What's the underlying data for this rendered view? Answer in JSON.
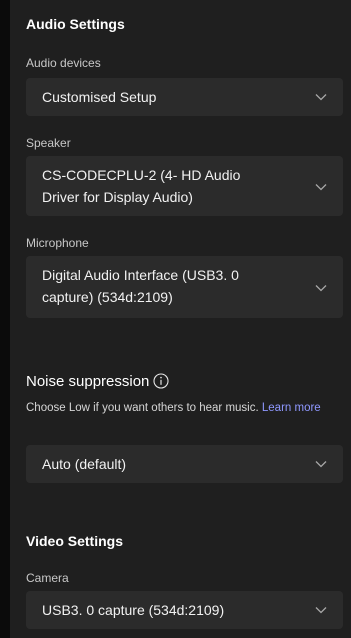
{
  "audio_settings": {
    "title": "Audio Settings",
    "audio_devices": {
      "label": "Audio devices",
      "value": "Customised Setup"
    },
    "speaker": {
      "label": "Speaker",
      "value_line1": "CS-CODECPLU-2 (4- HD Audio",
      "value_line2": "Driver for Display Audio)"
    },
    "microphone": {
      "label": "Microphone",
      "value_line1": "Digital Audio Interface (USB3. 0",
      "value_line2": "capture) (534d:2109)"
    },
    "noise_suppression": {
      "label": "Noise suppression",
      "hint": "Choose Low if you want others to hear music.",
      "link_text": "Learn more",
      "value": "Auto (default)"
    }
  },
  "video_settings": {
    "title": "Video Settings",
    "camera": {
      "label": "Camera",
      "value": "USB3. 0 capture (534d:2109)"
    }
  },
  "colors": {
    "panel_bg": "#1f1f1f",
    "dropdown_bg": "#2b2b2b",
    "link": "#8f98ff"
  }
}
